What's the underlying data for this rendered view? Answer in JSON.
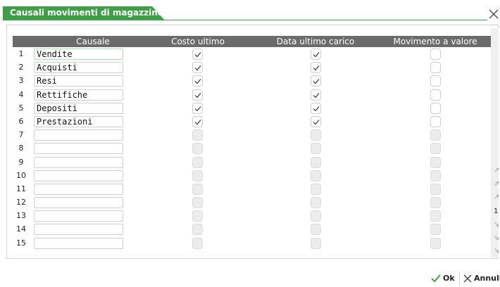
{
  "window": {
    "title": "Causali movimenti di magazzino"
  },
  "grid": {
    "columns": [
      "Causale",
      "Costo ultimo",
      "Data ultimo carico",
      "Movimento a valore"
    ],
    "rows": [
      {
        "num": "1",
        "causale": "Vendite",
        "costo_ultimo": true,
        "data_ultimo_carico": true,
        "movimento_a_valore": false,
        "enabled": true
      },
      {
        "num": "2",
        "causale": "Acquisti",
        "costo_ultimo": true,
        "data_ultimo_carico": true,
        "movimento_a_valore": false,
        "enabled": true
      },
      {
        "num": "3",
        "causale": "Resi",
        "costo_ultimo": true,
        "data_ultimo_carico": true,
        "movimento_a_valore": false,
        "enabled": true
      },
      {
        "num": "4",
        "causale": "Rettifiche",
        "costo_ultimo": true,
        "data_ultimo_carico": true,
        "movimento_a_valore": false,
        "enabled": true
      },
      {
        "num": "5",
        "causale": "Depositi",
        "costo_ultimo": true,
        "data_ultimo_carico": true,
        "movimento_a_valore": false,
        "enabled": true
      },
      {
        "num": "6",
        "causale": "Prestazioni",
        "costo_ultimo": true,
        "data_ultimo_carico": true,
        "movimento_a_valore": false,
        "enabled": true
      },
      {
        "num": "7",
        "causale": "",
        "costo_ultimo": false,
        "data_ultimo_carico": false,
        "movimento_a_valore": false,
        "enabled": false
      },
      {
        "num": "8",
        "causale": "",
        "costo_ultimo": false,
        "data_ultimo_carico": false,
        "movimento_a_valore": false,
        "enabled": false
      },
      {
        "num": "9",
        "causale": "",
        "costo_ultimo": false,
        "data_ultimo_carico": false,
        "movimento_a_valore": false,
        "enabled": false
      },
      {
        "num": "10",
        "causale": "",
        "costo_ultimo": false,
        "data_ultimo_carico": false,
        "movimento_a_valore": false,
        "enabled": false
      },
      {
        "num": "11",
        "causale": "",
        "costo_ultimo": false,
        "data_ultimo_carico": false,
        "movimento_a_valore": false,
        "enabled": false
      },
      {
        "num": "12",
        "causale": "",
        "costo_ultimo": false,
        "data_ultimo_carico": false,
        "movimento_a_valore": false,
        "enabled": false
      },
      {
        "num": "13",
        "causale": "",
        "costo_ultimo": false,
        "data_ultimo_carico": false,
        "movimento_a_valore": false,
        "enabled": false
      },
      {
        "num": "14",
        "causale": "",
        "costo_ultimo": false,
        "data_ultimo_carico": false,
        "movimento_a_valore": false,
        "enabled": false
      },
      {
        "num": "15",
        "causale": "",
        "costo_ultimo": false,
        "data_ultimo_carico": false,
        "movimento_a_valore": false,
        "enabled": false
      }
    ]
  },
  "scroll": {
    "icons": [
      "scroll-top-icon",
      "page-up-icon",
      "line-up-icon",
      "line-down-icon",
      "page-down-icon",
      "scroll-bottom-icon"
    ],
    "page_indicator": "1"
  },
  "footer": {
    "ok_label": "Ok",
    "cancel_label": "Annulla"
  },
  "colors": {
    "title_bar": "#3f9f47",
    "header": "#6b6b6b",
    "ok_icon": "#3f9f47"
  }
}
